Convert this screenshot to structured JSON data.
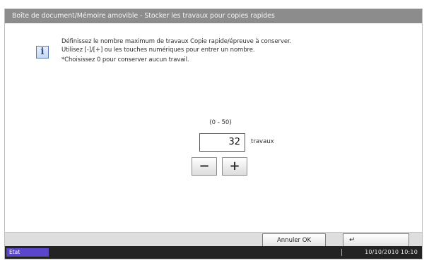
{
  "title": "Boîte de document/Mémoire amovible - Stocker les travaux pour copies rapides",
  "info_icon": "info-icon",
  "message": {
    "line1": "Définissez le nombre maximum de travaux Copie rapide/épreuve à conserver.",
    "line2": "Utilisez [-]/[+] ou les touches numériques pour entrer un nombre.",
    "line3": "*Choisissez 0 pour conserver aucun travail."
  },
  "range_label": "(0 - 50)",
  "value": "32",
  "unit_label": "travaux",
  "stepper": {
    "minus": "−",
    "plus": "+"
  },
  "buttons": {
    "cancel": "Annuler OK",
    "enter": "↵"
  },
  "status": {
    "state": "Etat",
    "datetime": "10/10/2010 10:10"
  }
}
